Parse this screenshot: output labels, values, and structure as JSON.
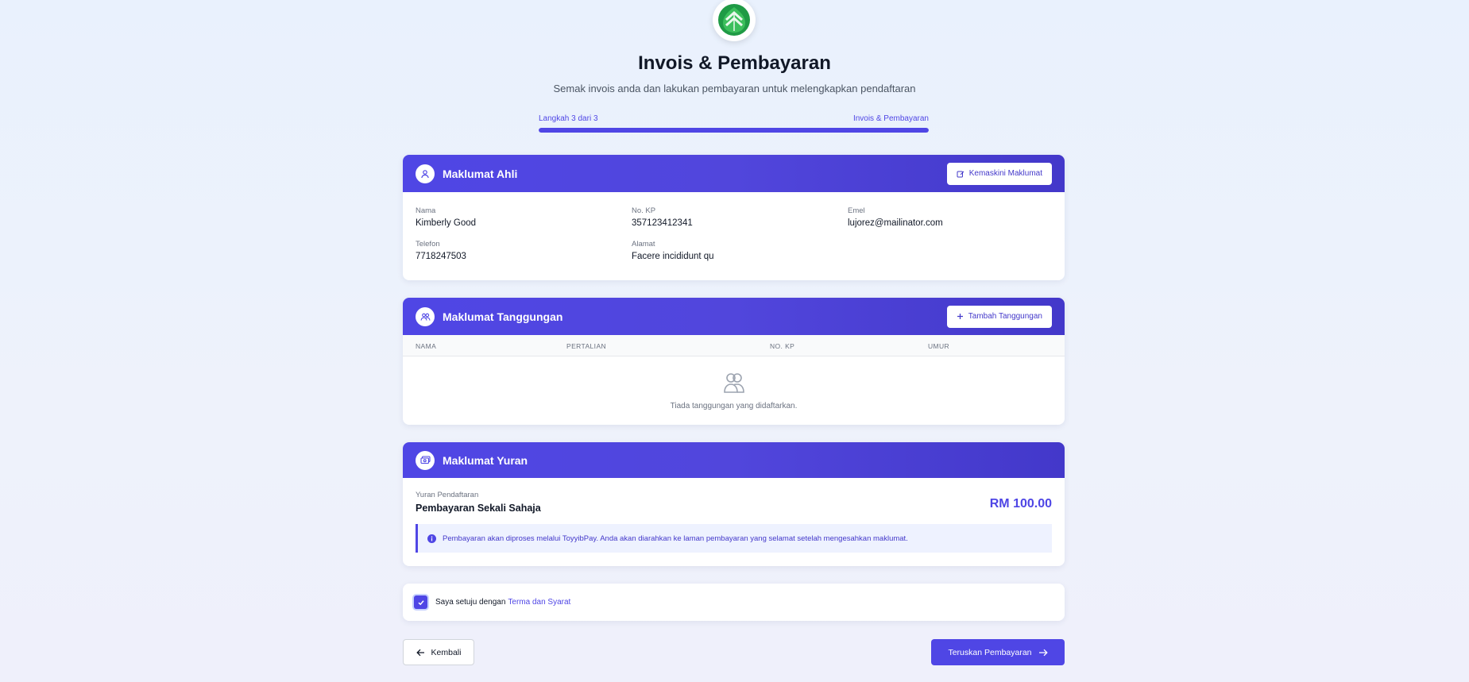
{
  "header": {
    "logo_icon": "leaf-chevron-logo",
    "title": "Invois & Pembayaran",
    "subtitle": "Semak invois anda dan lakukan pembayaran untuk melengkapkan pendaftaran"
  },
  "progress": {
    "step_text": "Langkah 3 dari 3",
    "step_name": "Invois & Pembayaran",
    "fraction": 1.0,
    "color": "#4f46e5"
  },
  "member": {
    "title": "Maklumat Ahli",
    "icon": "user-icon",
    "button_label": "Kemaskini Maklumat",
    "button_icon": "edit-icon",
    "fields": [
      {
        "label": "Nama",
        "value": "Kimberly Good"
      },
      {
        "label": "No. KP",
        "value": "357123412341"
      },
      {
        "label": "Emel",
        "value": "lujorez@mailinator.com"
      },
      {
        "label": "Telefon",
        "value": "7718247503"
      },
      {
        "label": "Alamat",
        "value": "Facere incididunt qu"
      }
    ]
  },
  "dependents": {
    "title": "Maklumat Tanggungan",
    "icon": "users-icon",
    "button_label": "Tambah Tanggungan",
    "button_icon": "plus-icon",
    "columns": [
      "NAMA",
      "PERTALIAN",
      "NO. KP",
      "UMUR"
    ],
    "rows": [],
    "empty_icon": "users-icon",
    "empty_text": "Tiada tanggungan yang didaftarkan."
  },
  "fees": {
    "title": "Maklumat Yuran",
    "icon": "money-icon",
    "label": "Yuran Pendaftaran",
    "name": "Pembayaran Sekali Sahaja",
    "amount": "RM 100.00",
    "notice_icon": "info-icon",
    "notice": "Pembayaran akan diproses melalui ToyyibPay. Anda akan diarahkan ke laman pembayaran yang selamat setelah mengesahkan maklumat."
  },
  "terms": {
    "checked": true,
    "text": "Saya setuju dengan",
    "link": "Terma dan Syarat"
  },
  "actions": {
    "back_label": "Kembali",
    "next_label": "Teruskan Pembayaran"
  },
  "colors": {
    "accent": "#4f46e5",
    "accent_dark": "#4338ca",
    "logo_green": "#22a447"
  }
}
